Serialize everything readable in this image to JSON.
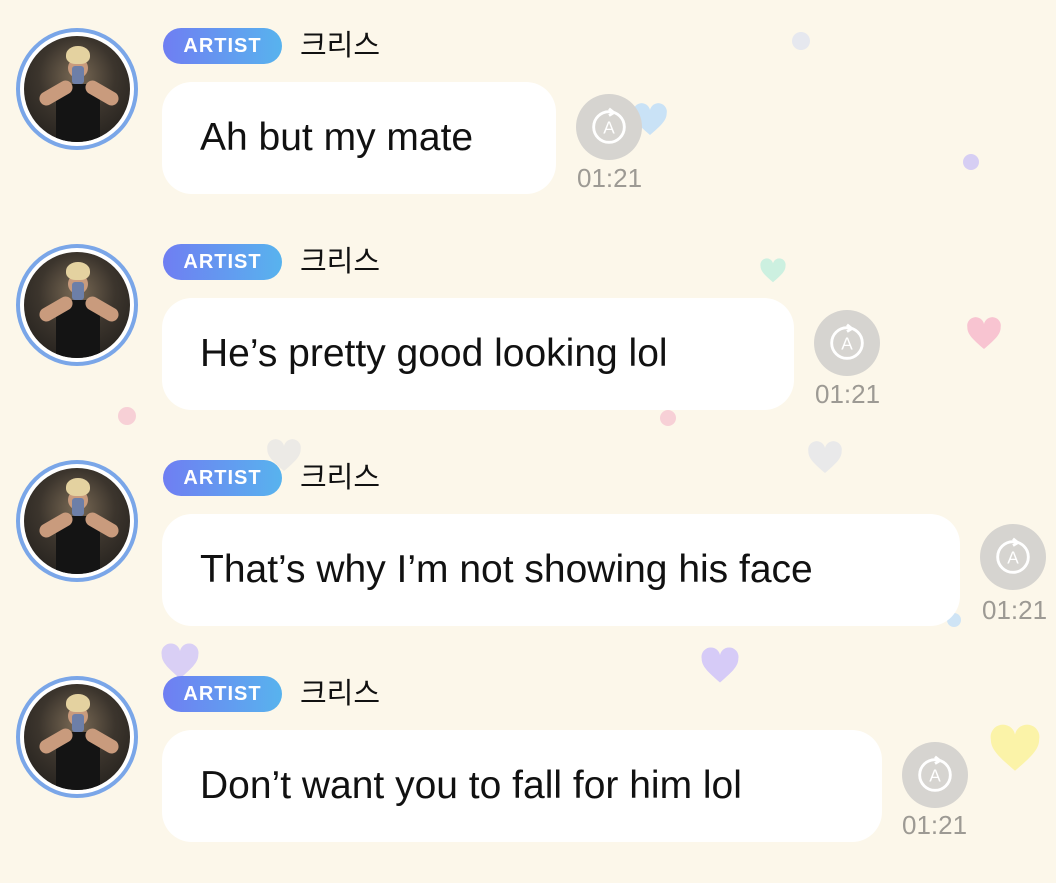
{
  "chat": {
    "messages": [
      {
        "badge": "ARTIST",
        "sender": "크리스",
        "text": "Ah but my mate",
        "time": "01:21"
      },
      {
        "badge": "ARTIST",
        "sender": "크리스",
        "text": "He’s pretty good looking lol",
        "time": "01:21"
      },
      {
        "badge": "ARTIST",
        "sender": "크리스",
        "text": "That’s why I’m not showing his face",
        "time": "01:21"
      },
      {
        "badge": "ARTIST",
        "sender": "크리스",
        "text": "Don’t want you to fall for him lol",
        "time": "01:21"
      }
    ]
  },
  "icons": {
    "avatar": "artist-avatar",
    "translate": "translate-icon",
    "decoration": "heart-icon"
  },
  "colors": {
    "background": "#fcf7ea",
    "badge_gradient_start": "#6f7ef2",
    "badge_gradient_end": "#58b3ee",
    "avatar_ring": "#7aa6e8",
    "bubble": "#ffffff",
    "timestamp": "#9d9a94"
  }
}
